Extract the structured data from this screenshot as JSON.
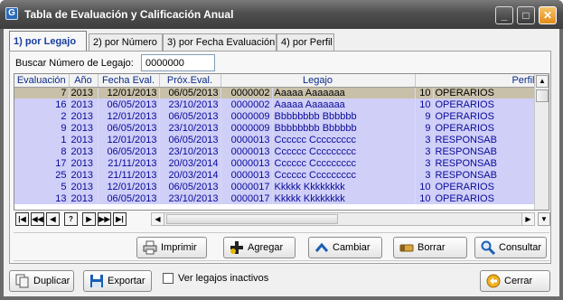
{
  "window": {
    "title": "Tabla de Evaluación y Calificación Anual"
  },
  "tabs": [
    {
      "label": "1) por Legajo",
      "active": true
    },
    {
      "label": "2) por Número",
      "active": false
    },
    {
      "label": "3) por Fecha Evaluación",
      "active": false
    },
    {
      "label": "4) por Perfil",
      "active": false
    }
  ],
  "search": {
    "label": "Buscar Número de Legajo:",
    "value": "0000000"
  },
  "grid": {
    "columns": [
      "Evaluación",
      "Año",
      "Fecha Eval.",
      "Próx.Eval.",
      "Legajo",
      "Perfil"
    ],
    "rows": [
      {
        "eval": "7",
        "year": "2013",
        "fecha": "12/01/2013",
        "prox": "06/05/2013",
        "legajo": "0000002",
        "nombre": "Aaaaa Aaaaaaa",
        "perfil_num": "10",
        "perfil": "OPERARIOS"
      },
      {
        "eval": "16",
        "year": "2013",
        "fecha": "06/05/2013",
        "prox": "23/10/2013",
        "legajo": "0000002",
        "nombre": "Aaaaa Aaaaaaa",
        "perfil_num": "10",
        "perfil": "OPERARIOS"
      },
      {
        "eval": "2",
        "year": "2013",
        "fecha": "12/01/2013",
        "prox": "06/05/2013",
        "legajo": "0000009",
        "nombre": "Bbbbbbbb Bbbbbb",
        "perfil_num": "9",
        "perfil": "OPERARIOS"
      },
      {
        "eval": "9",
        "year": "2013",
        "fecha": "06/05/2013",
        "prox": "23/10/2013",
        "legajo": "0000009",
        "nombre": "Bbbbbbbb Bbbbbb",
        "perfil_num": "9",
        "perfil": "OPERARIOS"
      },
      {
        "eval": "1",
        "year": "2013",
        "fecha": "12/01/2013",
        "prox": "06/05/2013",
        "legajo": "0000013",
        "nombre": "Cccccc Ccccccccc",
        "perfil_num": "3",
        "perfil": "RESPONSAB"
      },
      {
        "eval": "8",
        "year": "2013",
        "fecha": "06/05/2013",
        "prox": "23/10/2013",
        "legajo": "0000013",
        "nombre": "Cccccc Ccccccccc",
        "perfil_num": "3",
        "perfil": "RESPONSAB"
      },
      {
        "eval": "17",
        "year": "2013",
        "fecha": "21/11/2013",
        "prox": "20/03/2014",
        "legajo": "0000013",
        "nombre": "Cccccc Ccccccccc",
        "perfil_num": "3",
        "perfil": "RESPONSAB"
      },
      {
        "eval": "25",
        "year": "2013",
        "fecha": "21/11/2013",
        "prox": "20/03/2014",
        "legajo": "0000013",
        "nombre": "Cccccc Ccccccccc",
        "perfil_num": "3",
        "perfil": "RESPONSAB"
      },
      {
        "eval": "5",
        "year": "2013",
        "fecha": "12/01/2013",
        "prox": "06/05/2013",
        "legajo": "0000017",
        "nombre": "Kkkkk Kkkkkkkk",
        "perfil_num": "10",
        "perfil": "OPERARIOS"
      },
      {
        "eval": "13",
        "year": "2013",
        "fecha": "06/05/2013",
        "prox": "23/10/2013",
        "legajo": "0000017",
        "nombre": "Kkkkk Kkkkkkkk",
        "perfil_num": "10",
        "perfil": "OPERARIOS"
      }
    ],
    "selected_row": 0
  },
  "navigator": {
    "buttons": [
      "first",
      "prev-page",
      "prev",
      "help",
      "next",
      "next-page",
      "last"
    ]
  },
  "actions": {
    "imprimir": "Imprimir",
    "agregar": "Agregar",
    "cambiar": "Cambiar",
    "borrar": "Borrar",
    "consultar": "Consultar"
  },
  "bottom": {
    "duplicar": "Duplicar",
    "exportar": "Exportar",
    "ver_inactivos": "Ver legajos inactivos",
    "cerrar": "Cerrar"
  }
}
